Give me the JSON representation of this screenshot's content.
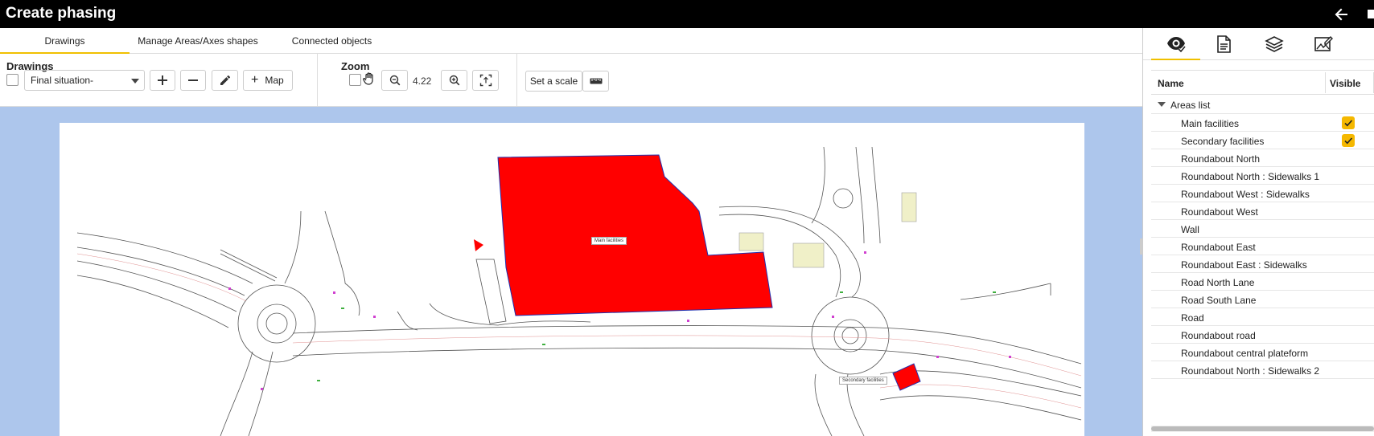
{
  "window": {
    "title": "Create phasing"
  },
  "tabs": [
    "Drawings",
    "Manage Areas/Axes shapes",
    "Connected objects"
  ],
  "toolbar": {
    "drawings_heading": "Drawings",
    "drawing_select": "Final situation-",
    "map_label": "Map",
    "zoom_heading": "Zoom",
    "zoom_value": "4.22",
    "set_scale_label": "Set a scale"
  },
  "canvas": {
    "labels": {
      "main": "Main facilities",
      "secondary": "Secondary facilities"
    },
    "area_color": "#ff0000",
    "background_color": "#adc6ec"
  },
  "right_panel": {
    "tabs": [
      "visibility-eye-icon",
      "document-icon",
      "layers-icon",
      "image-edit-icon"
    ],
    "columns": {
      "name": "Name",
      "visible": "Visible"
    },
    "group": "Areas list",
    "rows": [
      {
        "label": "Main facilities",
        "visible": true
      },
      {
        "label": "Secondary facilities",
        "visible": true
      },
      {
        "label": "Roundabout North",
        "visible": false
      },
      {
        "label": "Roundabout North : Sidewalks 1",
        "visible": false
      },
      {
        "label": "Roundabout West : Sidewalks",
        "visible": false
      },
      {
        "label": "Roundabout West",
        "visible": false
      },
      {
        "label": "Wall",
        "visible": false
      },
      {
        "label": "Roundabout East",
        "visible": false
      },
      {
        "label": "Roundabout East : Sidewalks",
        "visible": false
      },
      {
        "label": "Road North Lane",
        "visible": false
      },
      {
        "label": "Road South Lane",
        "visible": false
      },
      {
        "label": "Road",
        "visible": false
      },
      {
        "label": "Roundabout road",
        "visible": false
      },
      {
        "label": "Roundabout central plateform",
        "visible": false
      },
      {
        "label": "Roundabout North : Sidewalks 2",
        "visible": false
      }
    ]
  }
}
